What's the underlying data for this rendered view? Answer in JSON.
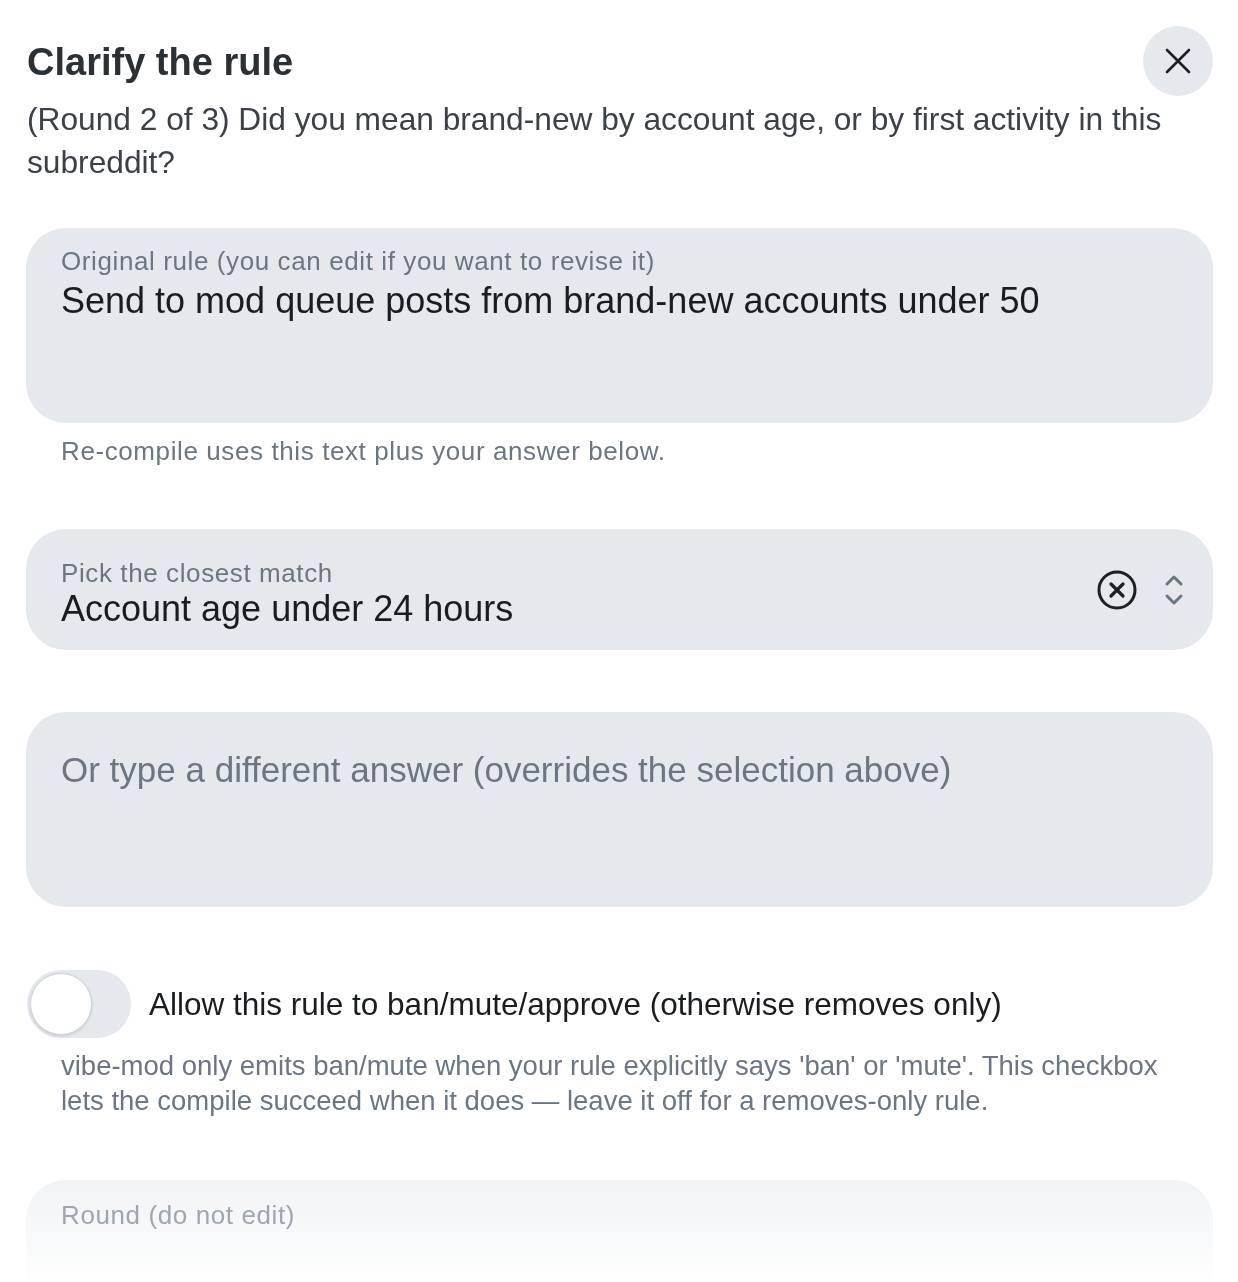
{
  "dialog": {
    "title": "Clarify the rule",
    "question": "(Round 2 of 3) Did you mean brand-new by account age, or by first activity in this subreddit?"
  },
  "rule_field": {
    "label": "Original rule (you can edit if you want to revise it)",
    "value": "Send to mod queue posts from brand-new accounts under 50",
    "help": "Re-compile uses this text plus your answer below."
  },
  "answer_select": {
    "label": "Pick the closest match",
    "value": "Account age under 24 hours"
  },
  "other_answer": {
    "placeholder": "Or type a different answer (overrides the selection above)"
  },
  "permission_toggle": {
    "label": "Allow this rule to ban/mute/approve (otherwise removes only)",
    "on": false,
    "help": "vibe-mod only emits ban/mute when your rule explicitly says 'ban' or 'mute'. This checkbox lets the compile succeed when it does — leave it off for a removes-only rule."
  },
  "round_field": {
    "label": "Round (do not edit)"
  }
}
